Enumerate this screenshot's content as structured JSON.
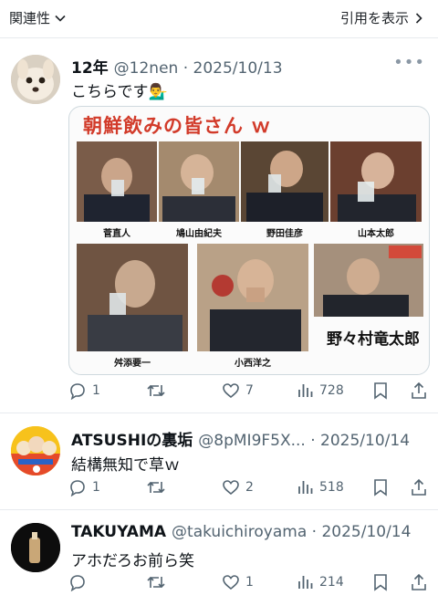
{
  "header": {
    "related_label": "関連性",
    "quote_label": "引用を表示"
  },
  "tweets": [
    {
      "name": "12年",
      "handle_date": "@12nen · 2025/10/13",
      "text": "こちらです💁‍♂️",
      "media": {
        "title": "朝鮮飲みの皆さん ｗ",
        "captions": [
          "菅直人",
          "鳩山由紀夫",
          "野田佳彦",
          "山本太郎",
          "舛添要一",
          "小西洋之",
          "野々村竜太郎"
        ]
      },
      "reply_count": "1",
      "retweet_count": "",
      "like_count": "7",
      "view_count": "728"
    },
    {
      "name": "ATSUSHIの裏垢",
      "handle_date": "@8pMI9F5X... · 2025/10/14",
      "text": "結構無知で草ｗ",
      "reply_count": "1",
      "retweet_count": "",
      "like_count": "2",
      "view_count": "518"
    },
    {
      "name": "TAKUYAMA",
      "handle_date": "@takuichiroyama · 2025/10/14",
      "text": "アホだろお前ら笑",
      "reply_count": "",
      "retweet_count": "",
      "like_count": "1",
      "view_count": "214"
    }
  ],
  "colors": {
    "text": "#0f1419",
    "muted": "#536471",
    "accent_red": "#d23b2a"
  },
  "icons": [
    "chevron-down-icon",
    "chevron-right-icon",
    "more-icon",
    "reply-icon",
    "retweet-icon",
    "like-icon",
    "views-icon",
    "bookmark-icon",
    "share-icon"
  ]
}
